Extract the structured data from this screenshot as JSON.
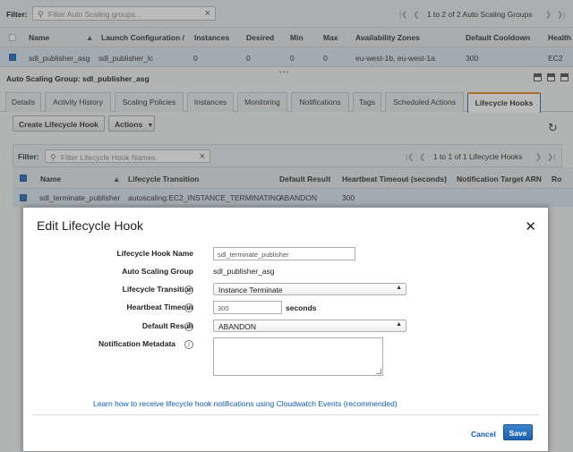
{
  "top_filter": {
    "label": "Filter:",
    "placeholder": "Filter Auto Scaling groups...",
    "pager_text": "1 to 2 of 2 Auto Scaling Groups"
  },
  "asg_table": {
    "headers": [
      "Name",
      "Launch Configuration /",
      "Instances",
      "Desired",
      "Min",
      "Max",
      "Availability Zones",
      "Default Cooldown",
      "Health C"
    ],
    "row": [
      "sdl_publisher_asg",
      "sdl_publisher_lc",
      "0",
      "0",
      "0",
      "0",
      "eu-west-1b, eu-west-1a",
      "300",
      "EC2"
    ]
  },
  "detail": {
    "title": "Auto Scaling Group: sdl_publisher_asg"
  },
  "tabs": [
    "Details",
    "Activity History",
    "Scaling Policies",
    "Instances",
    "Monitoring",
    "Notifications",
    "Tags",
    "Scheduled Actions",
    "Lifecycle Hooks"
  ],
  "toolbar": {
    "create_label": "Create Lifecycle Hook",
    "actions_label": "Actions"
  },
  "hooks_filter": {
    "label": "Filter:",
    "placeholder": "Filter Lifecycle Hook Names",
    "pager_text": "1 to 1 of 1 Lifecycle Hooks"
  },
  "hooks_table": {
    "headers": [
      "Name",
      "Lifecycle Transition",
      "Default Result",
      "Heartbeat Timeout (seconds)",
      "Notification Target ARN",
      "Ro"
    ],
    "row": [
      "sdl_terminate_publisher",
      "autoscaling:EC2_INSTANCE_TERMINATING",
      "ABANDON",
      "300"
    ]
  },
  "modal": {
    "title": "Edit Lifecycle Hook",
    "labels": {
      "hook_name": "Lifecycle Hook Name",
      "asg": "Auto Scaling Group",
      "transition": "Lifecycle Transition",
      "heartbeat": "Heartbeat Timeout",
      "default_result": "Default Result",
      "metadata": "Notification Metadata"
    },
    "values": {
      "hook_name": "sdl_terminate_publisher",
      "asg": "sdl_publisher_asg",
      "transition": "Instance Terminate",
      "heartbeat": "300",
      "heartbeat_unit": "seconds",
      "default_result": "ABANDON",
      "metadata": ""
    },
    "link": "Learn how to receive lifecycle hook notifications using Cloudwatch Events (recommended)",
    "cancel_label": "Cancel",
    "save_label": "Save"
  },
  "colors": {
    "accent": "#2a6ebb",
    "link": "#0f5bb3",
    "active_tab_top": "#e98d2a",
    "selected_row": "#d9e6f2"
  }
}
